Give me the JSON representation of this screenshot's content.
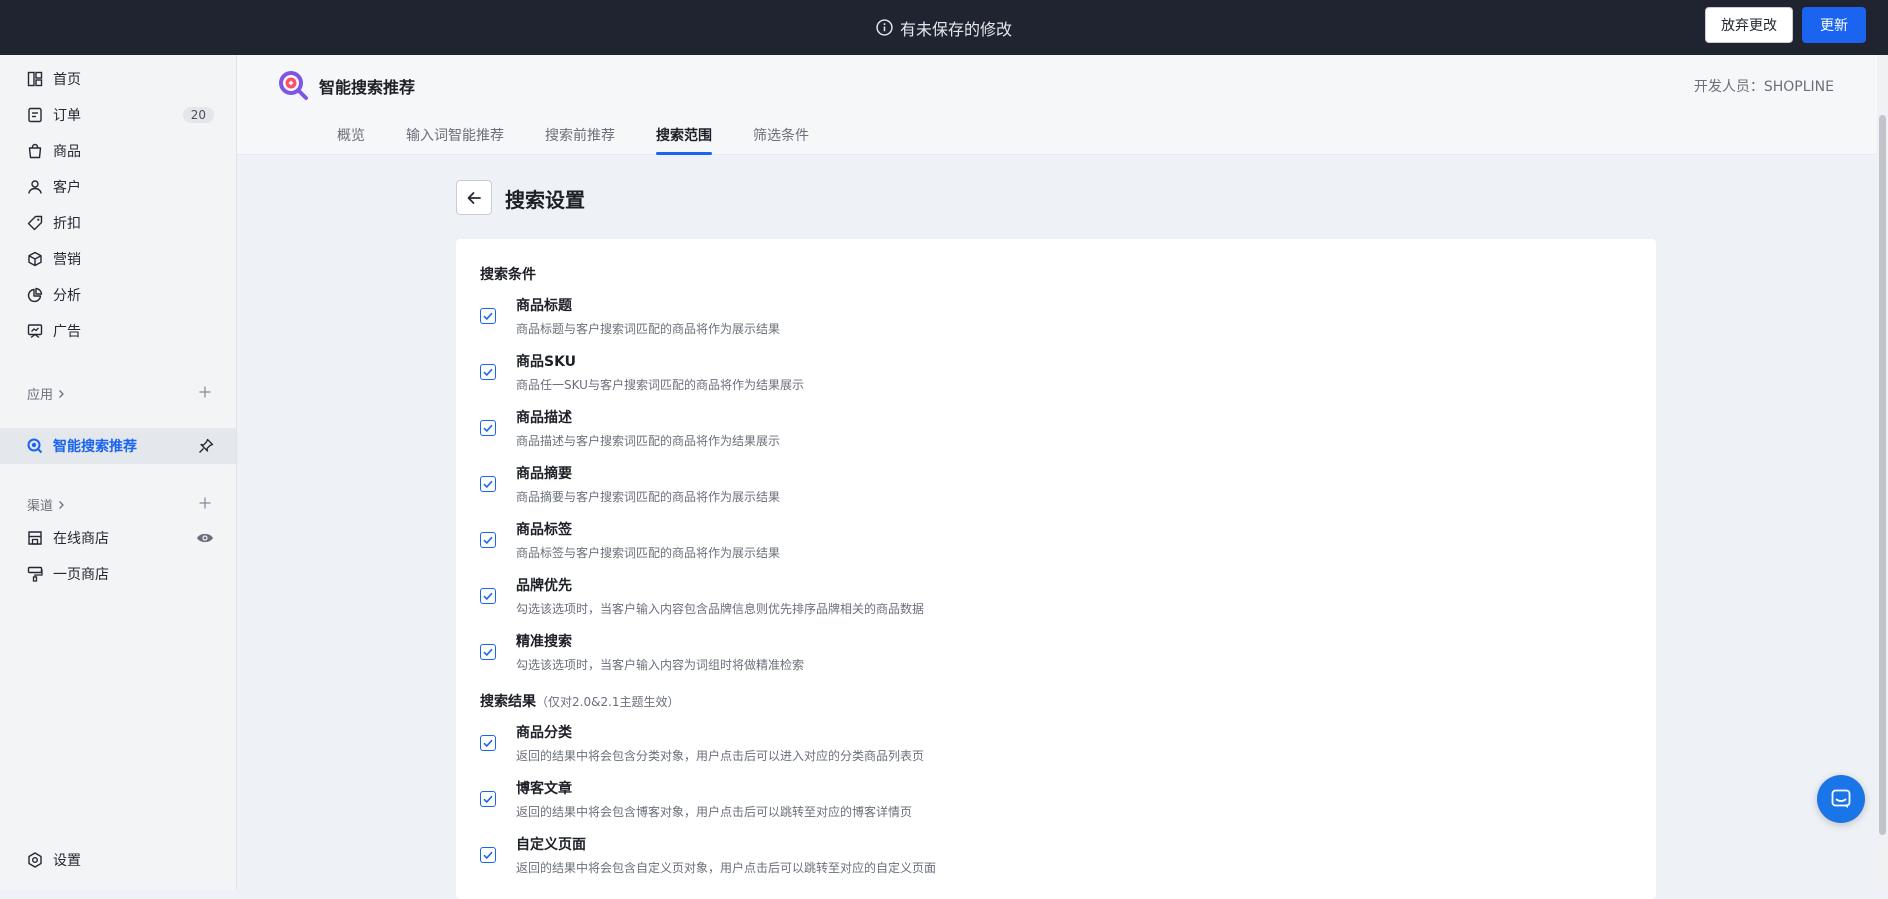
{
  "topbar": {
    "unsaved_message": "有未保存的修改",
    "discard_label": "放弃更改",
    "update_label": "更新"
  },
  "sidebar": {
    "items": [
      {
        "label": "首页",
        "icon": "home-icon"
      },
      {
        "label": "订单",
        "icon": "order-icon",
        "count": "20"
      },
      {
        "label": "商品",
        "icon": "bag-icon"
      },
      {
        "label": "客户",
        "icon": "user-icon"
      },
      {
        "label": "折扣",
        "icon": "tag-icon"
      },
      {
        "label": "营销",
        "icon": "cube-icon"
      },
      {
        "label": "分析",
        "icon": "pie-icon"
      },
      {
        "label": "广告",
        "icon": "ad-icon"
      }
    ],
    "apps_label": "应用",
    "active_app": "智能搜索推荐",
    "channels_label": "渠道",
    "channels": [
      {
        "label": "在线商店",
        "icon": "store-icon"
      },
      {
        "label": "一页商店",
        "icon": "brush-icon"
      }
    ],
    "settings_label": "设置"
  },
  "app": {
    "title": "智能搜索推荐",
    "developer": "开发人员：SHOPLINE",
    "tabs": [
      "概览",
      "输入词智能推荐",
      "搜索前推荐",
      "搜索范围",
      "筛选条件"
    ],
    "active_tab": "搜索范围"
  },
  "page": {
    "title": "搜索设置",
    "search_conditions_title": "搜索条件",
    "search_conditions": [
      {
        "label": "商品标题",
        "desc": "商品标题与客户搜索词匹配的商品将作为展示结果",
        "checked": true
      },
      {
        "label": "商品SKU",
        "desc": "商品任一SKU与客户搜索词匹配的商品将作为结果展示",
        "checked": true
      },
      {
        "label": "商品描述",
        "desc": "商品描述与客户搜索词匹配的商品将作为结果展示",
        "checked": true
      },
      {
        "label": "商品摘要",
        "desc": "商品摘要与客户搜索词匹配的商品将作为展示结果",
        "checked": true
      },
      {
        "label": "商品标签",
        "desc": "商品标签与客户搜索词匹配的商品将作为展示结果",
        "checked": true
      },
      {
        "label": "品牌优先",
        "desc": "勾选该选项时，当客户输入内容包含品牌信息则优先排序品牌相关的商品数据",
        "checked": true
      },
      {
        "label": "精准搜索",
        "desc": "勾选该选项时，当客户输入内容为词组时将做精准检索",
        "checked": true
      }
    ],
    "search_results_title": "搜索结果",
    "search_results_note": "（仅对2.0&2.1主题生效）",
    "search_results": [
      {
        "label": "商品分类",
        "desc": "返回的结果中将会包含分类对象，用户点击后可以进入对应的分类商品列表页",
        "checked": true
      },
      {
        "label": "博客文章",
        "desc": "返回的结果中将会包含博客对象，用户点击后可以跳转至对应的博客详情页",
        "checked": true
      },
      {
        "label": "自定义页面",
        "desc": "返回的结果中将会包含自定义页对象，用户点击后可以跳转至对应的自定义页面",
        "checked": true
      }
    ]
  },
  "colors": {
    "accent": "#1a64f0",
    "topbar_bg": "#1f2430",
    "sidebar_bg": "#f3f4f6"
  }
}
